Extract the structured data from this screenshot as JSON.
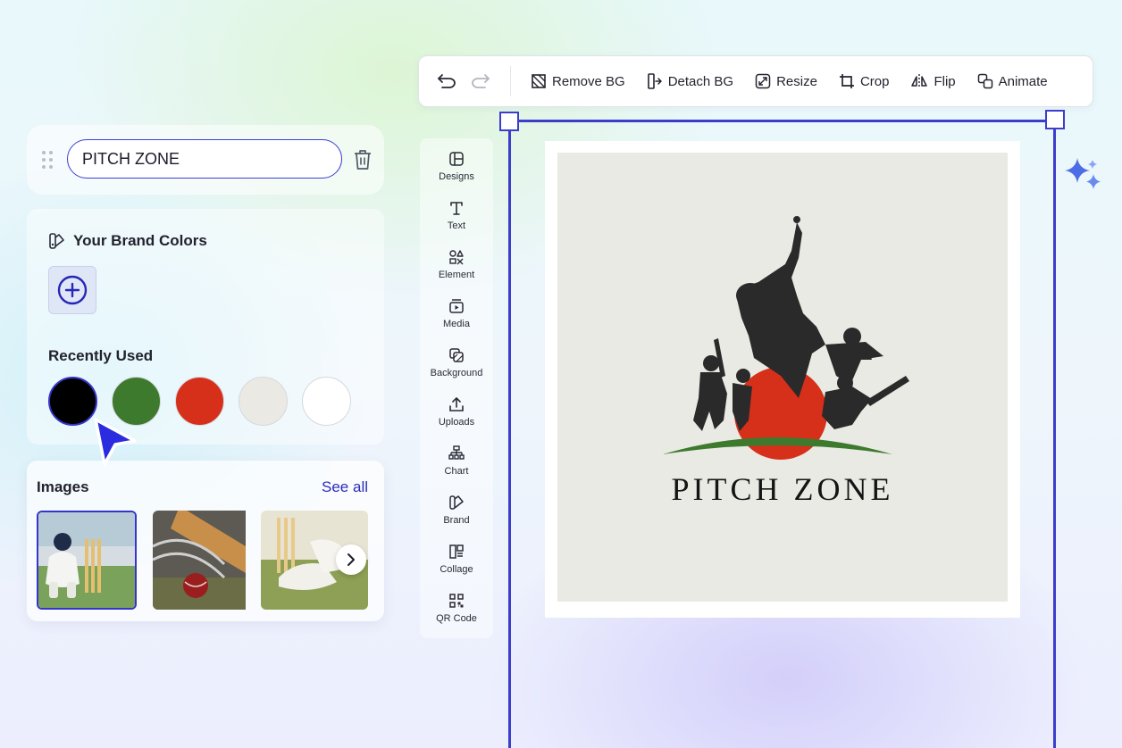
{
  "toolbar": {
    "remove_bg": "Remove BG",
    "detach_bg": "Detach BG",
    "resize": "Resize",
    "crop": "Crop",
    "flip": "Flip",
    "animate": "Animate"
  },
  "element_name": {
    "value": "PITCH ZONE"
  },
  "brand": {
    "title": "Your Brand Colors",
    "recent_title": "Recently Used",
    "recent_colors": [
      "#000000",
      "#3d7a2e",
      "#d6301a",
      "#eae9e4",
      "#ffffff"
    ]
  },
  "images": {
    "title": "Images",
    "see_all": "See all"
  },
  "sidebar": {
    "items": [
      {
        "label": "Designs",
        "icon": "layout-icon"
      },
      {
        "label": "Text",
        "icon": "text-icon"
      },
      {
        "label": "Element",
        "icon": "shapes-icon"
      },
      {
        "label": "Media",
        "icon": "media-icon"
      },
      {
        "label": "Background",
        "icon": "background-icon"
      },
      {
        "label": "Uploads",
        "icon": "upload-icon"
      },
      {
        "label": "Chart",
        "icon": "chart-icon"
      },
      {
        "label": "Brand",
        "icon": "brand-icon"
      },
      {
        "label": "Collage",
        "icon": "collage-icon"
      },
      {
        "label": "QR Code",
        "icon": "qr-code-icon"
      }
    ]
  },
  "canvas": {
    "logo_text": "PITCH ZONE"
  },
  "colors": {
    "accent": "#3d3dcc",
    "logo_red": "#d6301a",
    "logo_green": "#3d7a2e"
  }
}
